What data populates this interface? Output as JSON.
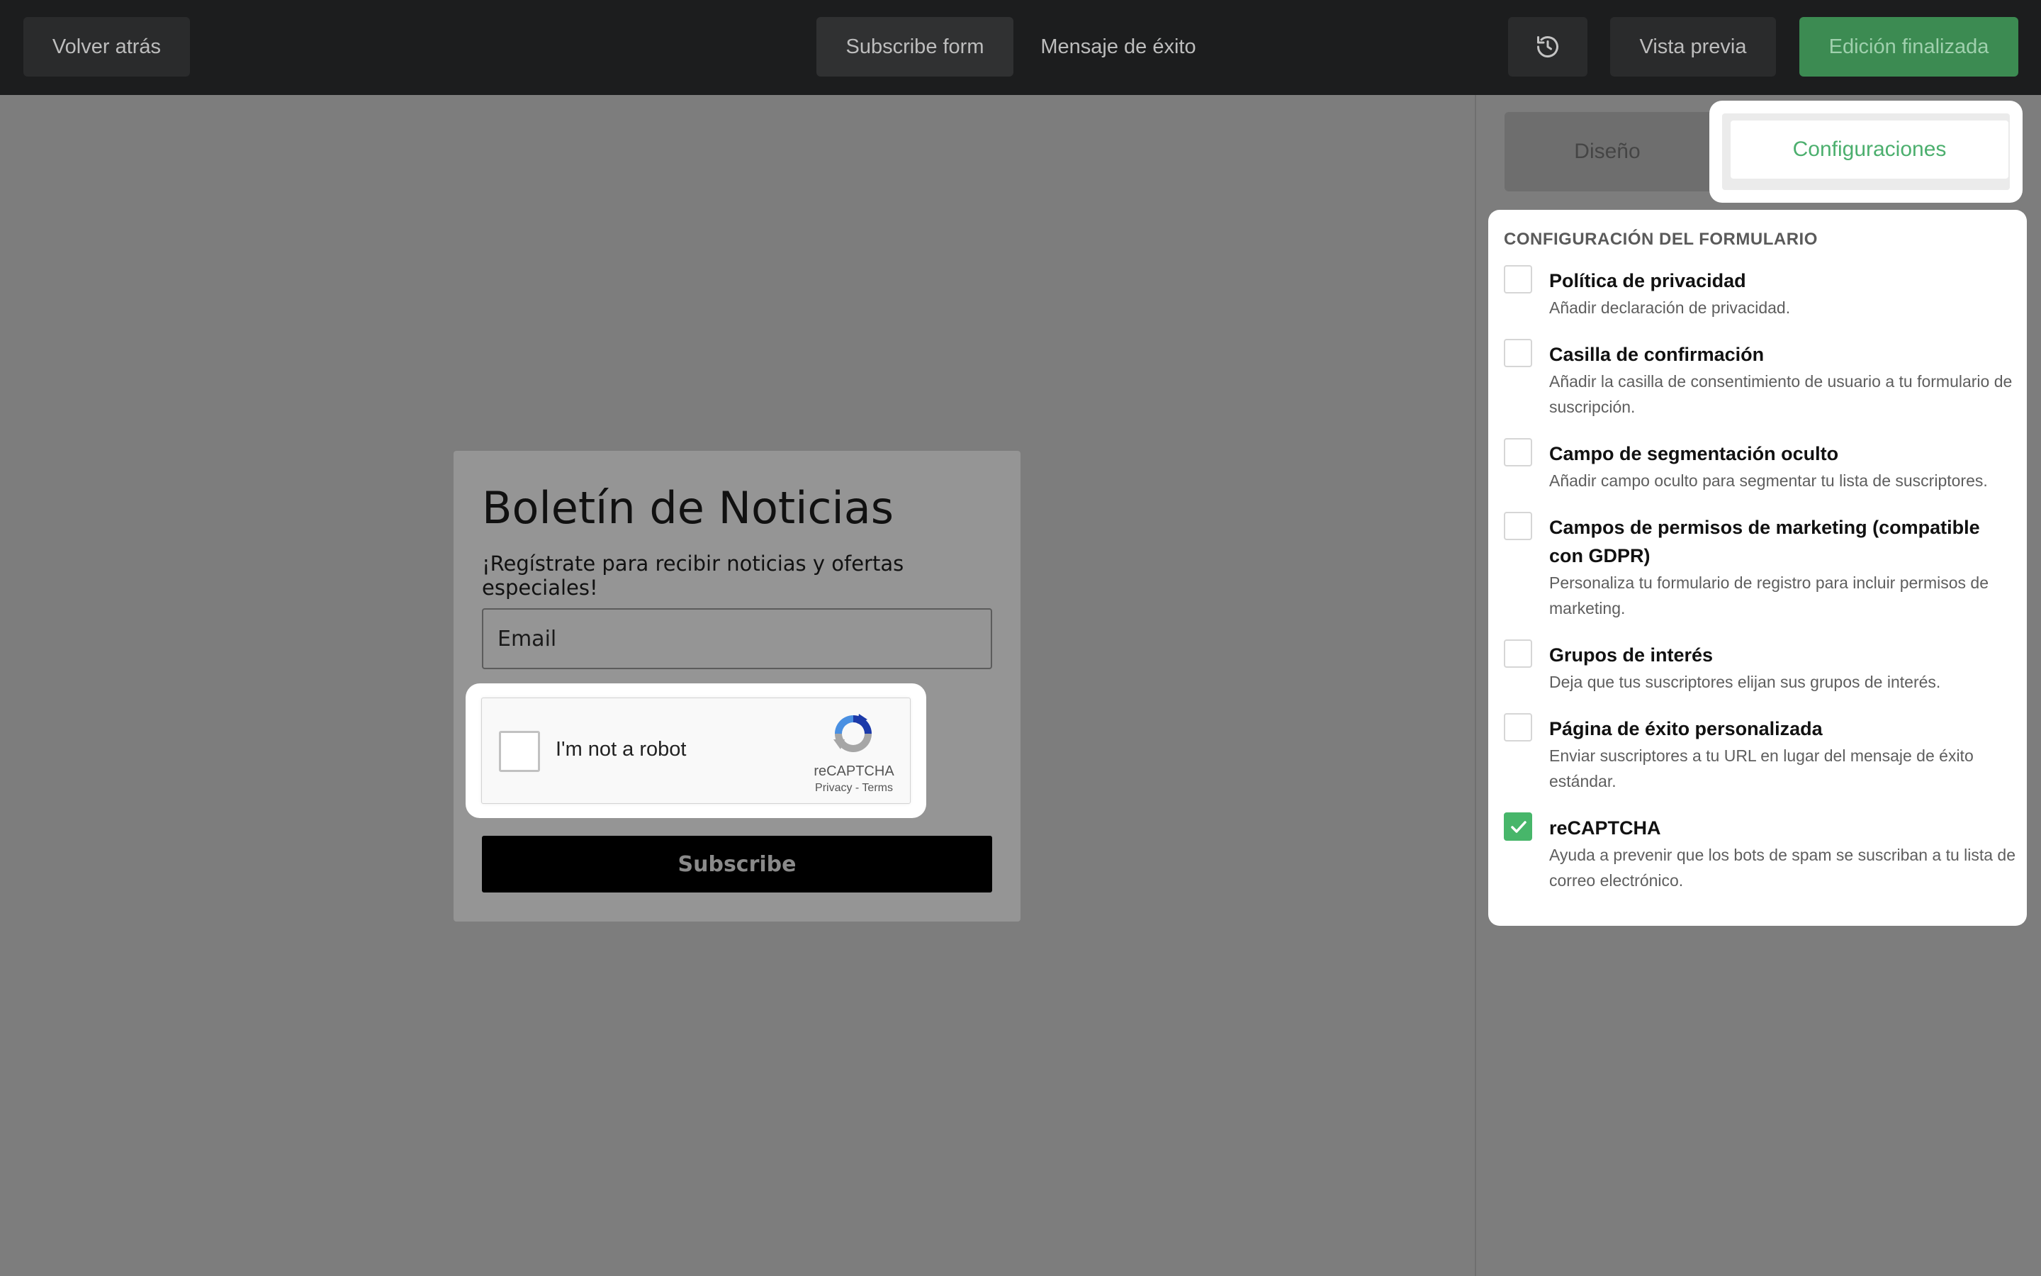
{
  "topbar": {
    "back_label": "Volver atrás",
    "tab_form": "Subscribe form",
    "tab_success": "Mensaje de éxito",
    "history_icon": "history-icon",
    "preview_label": "Vista previa",
    "done_label": "Edición finalizada"
  },
  "form": {
    "title": "Boletín de Noticias",
    "subtitle": "¡Regístrate para recibir noticias y ofertas especiales!",
    "email_placeholder": "Email",
    "submit_label": "Subscribe"
  },
  "captcha": {
    "label": "I'm not a robot",
    "brand": "reCAPTCHA",
    "links": "Privacy - Terms",
    "checked": false
  },
  "panel": {
    "tab_design": "Diseño",
    "tab_config": "Configuraciones",
    "heading": "CONFIGURACIÓN DEL FORMULARIO",
    "options": [
      {
        "title": "Política de privacidad",
        "desc": "Añadir declaración de privacidad.",
        "checked": false
      },
      {
        "title": "Casilla de confirmación",
        "desc": "Añadir la casilla de consentimiento de usuario a tu formulario de suscripción.",
        "checked": false
      },
      {
        "title": "Campo de segmentación oculto",
        "desc": "Añadir campo oculto para segmentar tu lista de suscriptores.",
        "checked": false
      },
      {
        "title": "Campos de permisos de marketing (compatible con GDPR)",
        "desc": "Personaliza tu formulario de registro para incluir permisos de marketing.",
        "checked": false
      },
      {
        "title": "Grupos de interés",
        "desc": "Deja que tus suscriptores elijan sus grupos de interés.",
        "checked": false
      },
      {
        "title": "Página de éxito personalizada",
        "desc": "Enviar suscriptores a tu URL en lugar del mensaje de éxito estándar.",
        "checked": false
      },
      {
        "title": "reCAPTCHA",
        "desc": "Ayuda a prevenir que los bots de spam se suscriban a tu lista de correo electrónico.",
        "checked": true
      }
    ]
  },
  "colors": {
    "accent_green": "#47b66a",
    "topbar_bg": "#1c1d1e",
    "overlay_gray": "#7d7d7d"
  }
}
